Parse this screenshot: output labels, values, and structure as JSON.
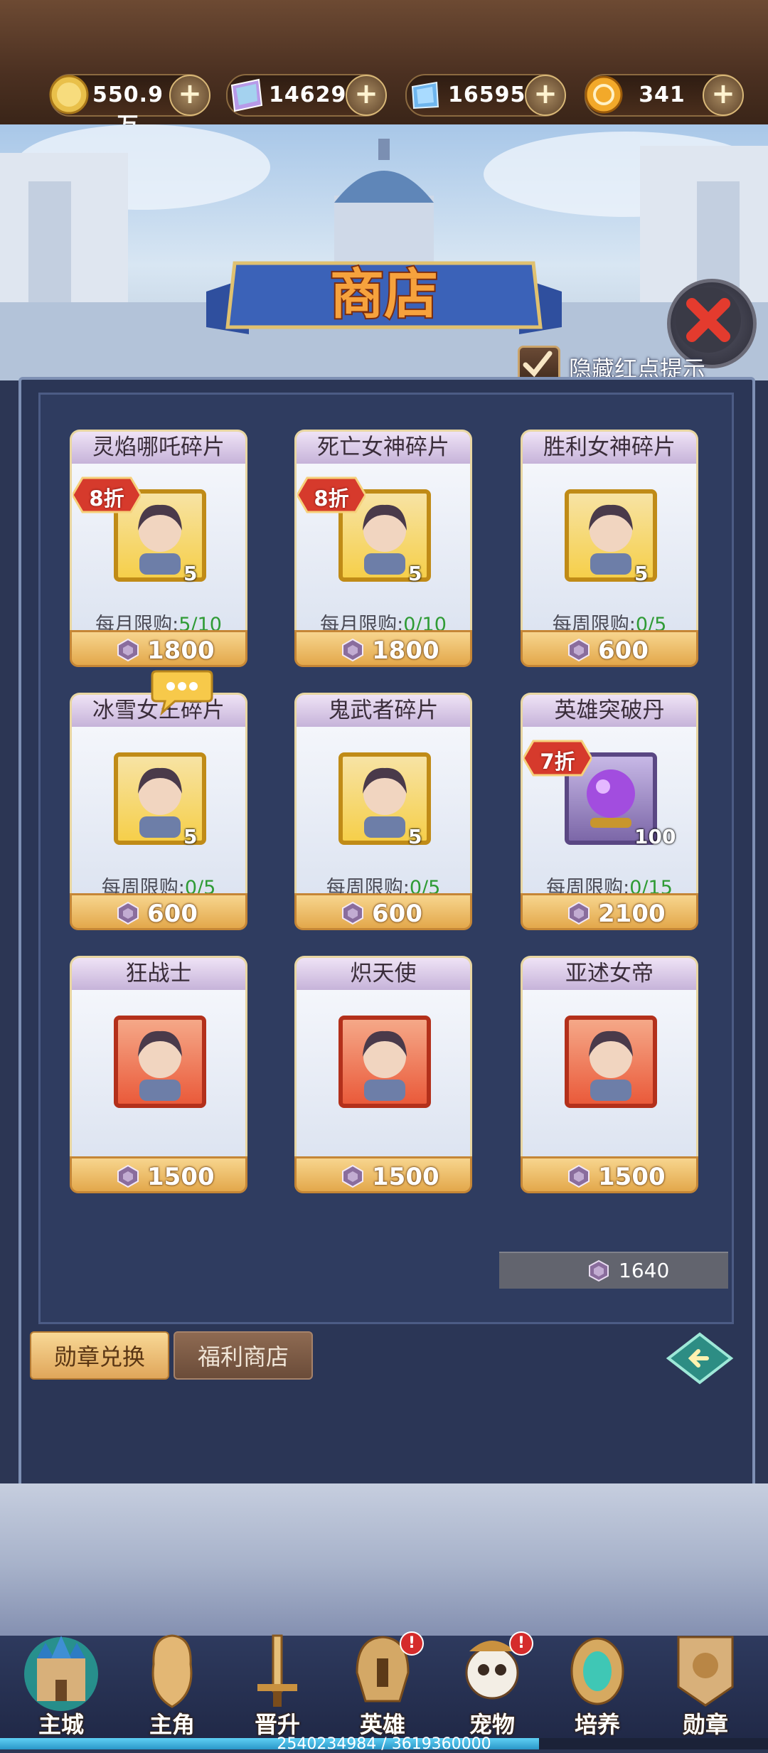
{
  "resources": [
    {
      "icon": "gold-coin-icon",
      "value": "550.9万"
    },
    {
      "icon": "rainbow-crystal-icon",
      "value": "146293"
    },
    {
      "icon": "blue-diamond-icon",
      "value": "165953"
    },
    {
      "icon": "orange-token-icon",
      "value": "341"
    }
  ],
  "title": "商店",
  "hide_red_dot_label": "隐藏红点提示",
  "hide_red_dot_checked": true,
  "items": [
    {
      "name": "灵焰哪吒碎片",
      "discount": "8折",
      "count": "5",
      "limit_label": "每月限购:",
      "limit_value": "5/10",
      "price": "1800",
      "frame": "gold"
    },
    {
      "name": "死亡女神碎片",
      "discount": "8折",
      "count": "5",
      "limit_label": "每月限购:",
      "limit_value": "0/10",
      "price": "1800",
      "frame": "gold"
    },
    {
      "name": "胜利女神碎片",
      "discount": "",
      "count": "5",
      "limit_label": "每周限购:",
      "limit_value": "0/5",
      "price": "600",
      "frame": "gold"
    },
    {
      "name": "冰雪女王碎片",
      "discount": "",
      "count": "5",
      "limit_label": "每周限购:",
      "limit_value": "0/5",
      "price": "600",
      "frame": "gold"
    },
    {
      "name": "鬼武者碎片",
      "discount": "",
      "count": "5",
      "limit_label": "每周限购:",
      "limit_value": "0/5",
      "price": "600",
      "frame": "gold"
    },
    {
      "name": "英雄突破丹",
      "discount": "7折",
      "count": "100",
      "limit_label": "每周限购:",
      "limit_value": "0/15",
      "price": "2100",
      "frame": "purple"
    },
    {
      "name": "狂战士",
      "discount": "",
      "count": "",
      "limit_label": "",
      "limit_value": "",
      "price": "1500",
      "frame": "red"
    },
    {
      "name": "炽天使",
      "discount": "",
      "count": "",
      "limit_label": "",
      "limit_value": "",
      "price": "1500",
      "frame": "red"
    },
    {
      "name": "亚述女帝",
      "discount": "",
      "count": "",
      "limit_label": "",
      "limit_value": "",
      "price": "1500",
      "frame": "red"
    }
  ],
  "balance": "1640",
  "tabs": {
    "medal_exchange": "勋章兑换",
    "welfare_shop": "福利商店"
  },
  "nav": [
    {
      "label": "主城",
      "icon": "castle-icon",
      "alert": false
    },
    {
      "label": "主角",
      "icon": "hero-silhouette-icon",
      "alert": false
    },
    {
      "label": "晋升",
      "icon": "sword-icon",
      "alert": false
    },
    {
      "label": "英雄",
      "icon": "helmet-icon",
      "alert": true
    },
    {
      "label": "宠物",
      "icon": "panda-icon",
      "alert": true
    },
    {
      "label": "培养",
      "icon": "gem-emblem-icon",
      "alert": false
    },
    {
      "label": "勋章",
      "icon": "medal-banner-icon",
      "alert": false
    }
  ],
  "xp": {
    "text": "2540234984 / 3619360000",
    "fraction": 0.702
  }
}
